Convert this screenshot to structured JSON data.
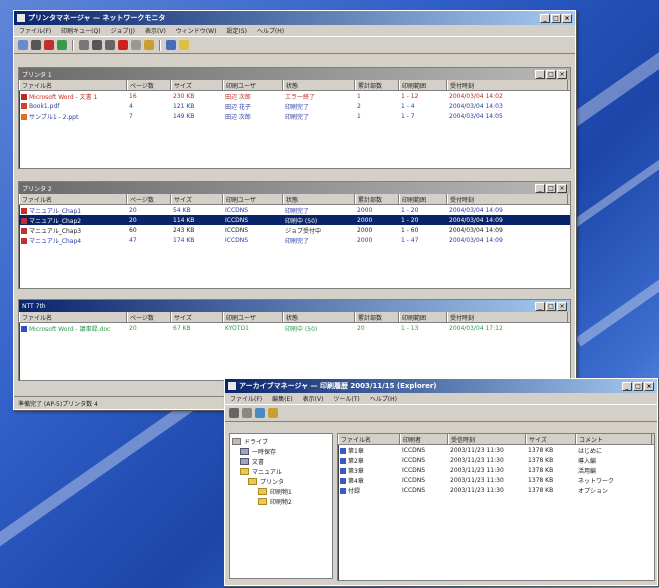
{
  "main_window": {
    "title": "プリンタマネージャ — ネットワークモニタ",
    "menu": [
      "ファイル(F)",
      "印刷キュー(Q)",
      "ジョブ(J)",
      "表示(V)",
      "ウィンドウ(W)",
      "設定(S)",
      "ヘルプ(H)"
    ],
    "toolbar_icons": [
      "open-icon",
      "print-icon",
      "save-icon",
      "refresh-icon",
      "doc-a-icon",
      "doc-b-icon",
      "doc-c-icon",
      "delete-icon",
      "pause-icon",
      "resume-icon",
      "settings-icon",
      "help-icon"
    ],
    "status": "準備完了 (AP-5)プリンタ数 4",
    "panels": [
      {
        "title": "プリンタ 1",
        "active": false,
        "columns": [
          "ファイル名",
          "ページ数",
          "サイズ",
          "印刷ユーザ",
          "状態",
          "累計部数",
          "印刷範囲",
          "受付時刻"
        ],
        "rows": [
          {
            "cells": [
              "Microsoft Word - 文書 1",
              "16",
              "230 KB",
              "田辺 次郎",
              "エラー終了",
              "1",
              "1 - 12",
              "2004/03/04 14:02"
            ],
            "color": "#c0281e",
            "icon": "#c0281e"
          },
          {
            "cells": [
              "Book1.pdf",
              "4",
              "121 KB",
              "田辺 花子",
              "印刷完了",
              "2",
              "1 - 4",
              "2004/03/04 14:03"
            ],
            "color": "#2a3aa0",
            "icon": "#d04030"
          },
          {
            "cells": [
              "サンプル1 - 2.ppt",
              "7",
              "149 KB",
              "田辺 次郎",
              "印刷完了",
              "1",
              "1 - 7",
              "2004/03/04 14:05"
            ],
            "color": "#2a3aa0",
            "icon": "#e07020"
          }
        ]
      },
      {
        "title": "プリンタ 2",
        "active": false,
        "columns": [
          "ファイル名",
          "ページ数",
          "サイズ",
          "印刷ユーザ",
          "状態",
          "累計部数",
          "印刷範囲",
          "受付時刻"
        ],
        "rows": [
          {
            "cells": [
              "マニュアル_Chap1",
              "20",
              "54 KB",
              "ICCDNS",
              "印刷完了",
              "2000",
              "1 - 20",
              "2004/03/04 14:09"
            ],
            "color": "#2a3aa0",
            "icon": "#c03030"
          },
          {
            "cells": [
              "マニュアル_Chap2",
              "20",
              "114 KB",
              "ICCDNS",
              "印刷中 (50)",
              "2000",
              "1 - 20",
              "2004/03/04 14:09"
            ],
            "color": "#ffffff",
            "icon": "#c03030",
            "selected": true
          },
          {
            "cells": [
              "マニュアル_Chap3",
              "60",
              "243 KB",
              "ICCDNS",
              "ジョブ受付中",
              "2000",
              "1 - 60",
              "2004/03/04 14:09"
            ],
            "color": "#222222",
            "icon": "#c03030"
          },
          {
            "cells": [
              "マニュアル_Chap4",
              "47",
              "174 KB",
              "ICCDNS",
              "印刷完了",
              "2000",
              "1 - 47",
              "2004/03/04 14:09"
            ],
            "color": "#2a3aa0",
            "icon": "#c03030"
          }
        ]
      },
      {
        "title": "NTT 7th",
        "active": true,
        "columns": [
          "ファイル名",
          "ページ数",
          "サイズ",
          "印刷ユーザ",
          "状態",
          "累計部数",
          "印刷範囲",
          "受付時刻"
        ],
        "rows": [
          {
            "cells": [
              "Microsoft Word - 議事録.doc",
              "20",
              "67 KB",
              "KYOTO1",
              "印刷中 (50)",
              "20",
              "1 - 13",
              "2004/03/04 17:12"
            ],
            "color": "#2a9a4a",
            "icon": "#3050c0"
          }
        ]
      }
    ]
  },
  "archive_window": {
    "title": "アーカイブマネージャ — 印刷履歴 2003/11/15 (Explorer)",
    "menu": [
      "ファイル(F)",
      "編集(E)",
      "表示(V)",
      "ツール(T)",
      "ヘルプ(H)"
    ],
    "toolbar_icons": [
      "back-icon",
      "forward-icon",
      "refresh-icon",
      "folder-up-icon"
    ],
    "tree": [
      {
        "label": "ドライブ",
        "level": 0
      },
      {
        "label": "一時保存",
        "level": 1
      },
      {
        "label": "文書",
        "level": 1
      },
      {
        "label": "マニュアル",
        "level": 1
      },
      {
        "label": "プリンタ",
        "level": 2
      },
      {
        "label": "印刷物1",
        "level": 3
      },
      {
        "label": "印刷物2",
        "level": 3
      }
    ],
    "columns": [
      "ファイル名",
      "印刷者",
      "受信時刻",
      "サイズ",
      "コメント"
    ],
    "rows": [
      [
        "第1章",
        "ICCDNS",
        "2003/11/23 11:30",
        "1378 KB",
        "はじめに"
      ],
      [
        "第2章",
        "ICCDNS",
        "2003/11/23 11:30",
        "1378 KB",
        "導入編"
      ],
      [
        "第3章",
        "ICCDNS",
        "2003/11/23 11:30",
        "1378 KB",
        "活用編"
      ],
      [
        "第4章",
        "ICCDNS",
        "2003/11/23 11:30",
        "1378 KB",
        "ネットワーク"
      ],
      [
        "付録",
        "ICCDNS",
        "2003/11/23 11:30",
        "1378 KB",
        "オプション"
      ]
    ]
  },
  "window_buttons": [
    "_",
    "□",
    "×"
  ]
}
